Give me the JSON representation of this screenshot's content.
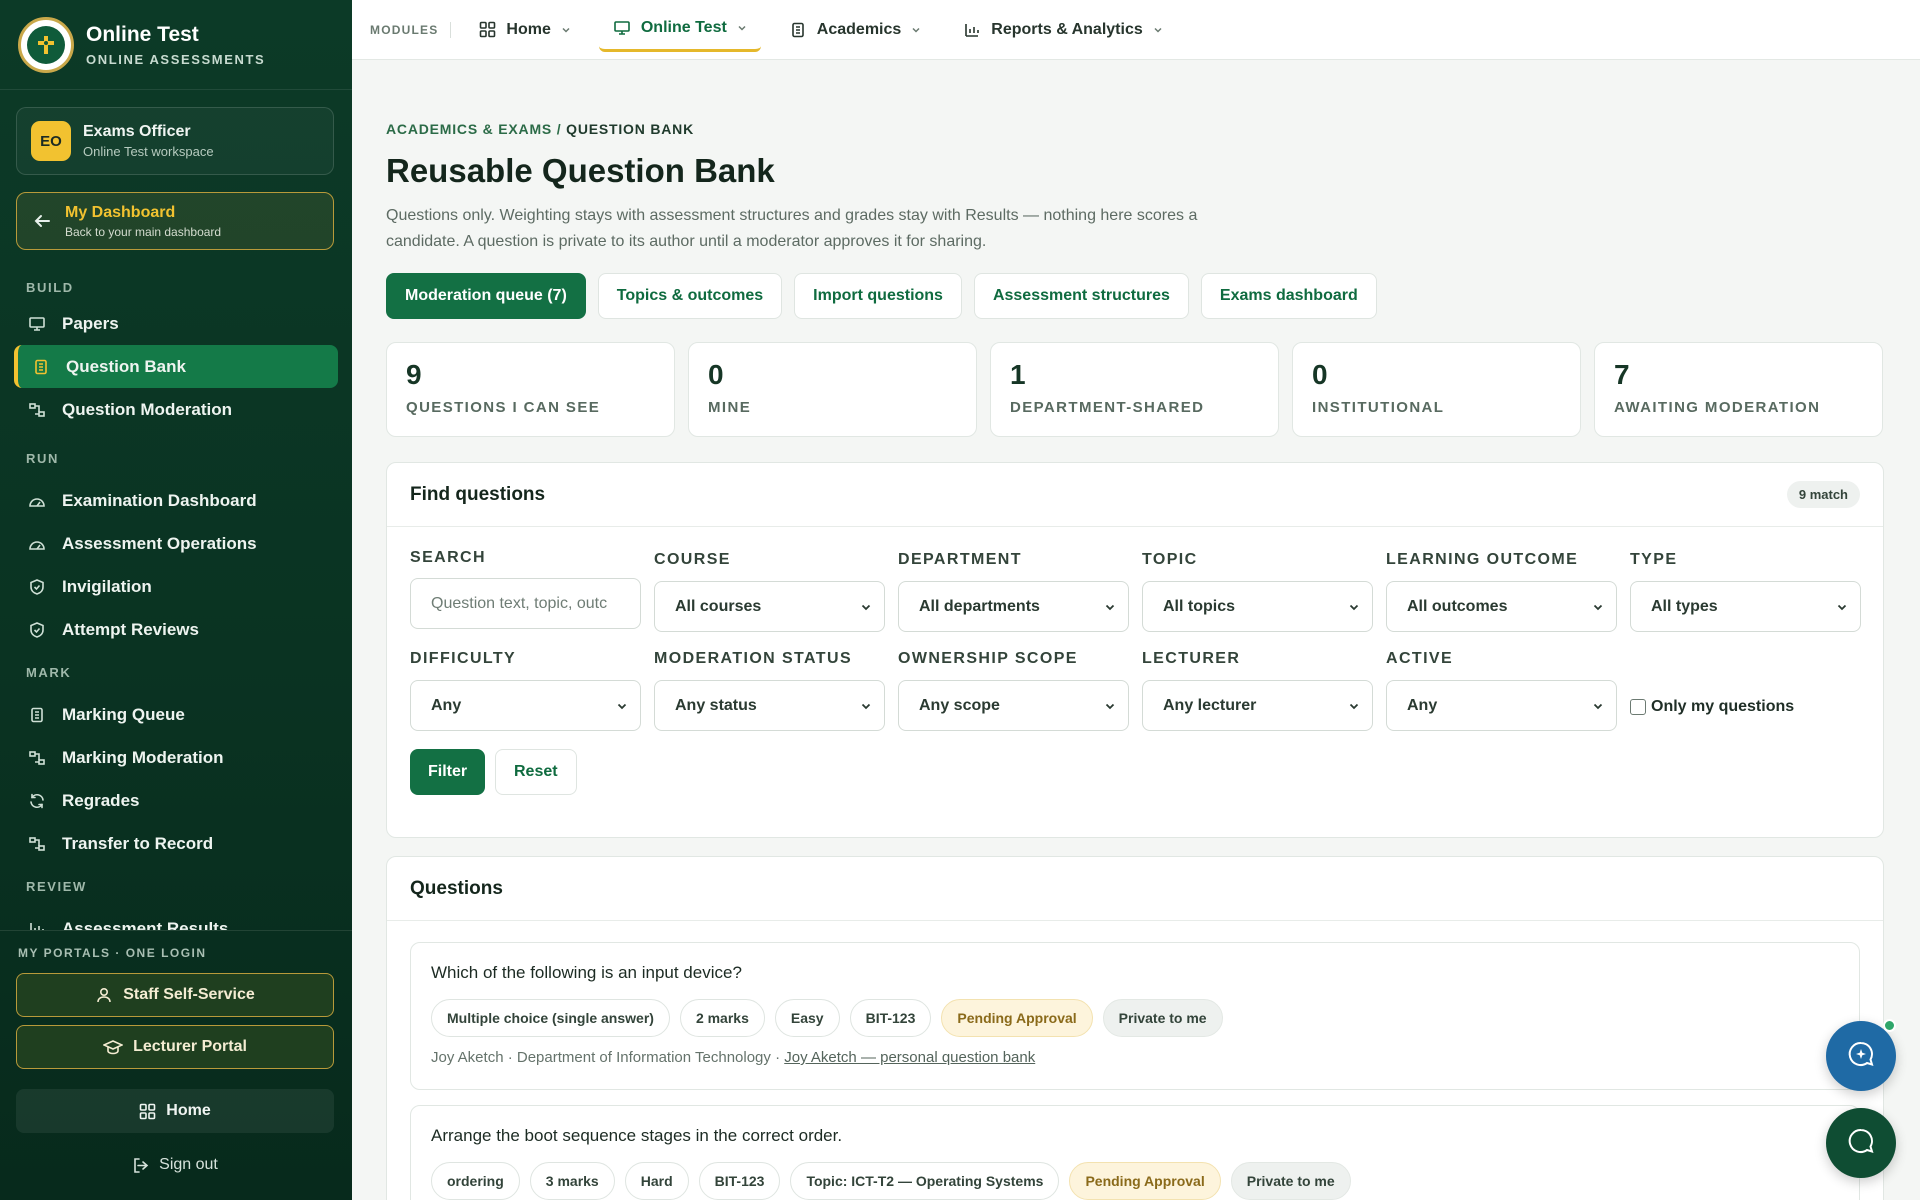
{
  "brand": {
    "title": "Online Test",
    "subtitle": "ONLINE ASSESSMENTS"
  },
  "user": {
    "initials": "EO",
    "name": "Exams Officer",
    "workspace": "Online Test workspace"
  },
  "dashboard": {
    "title": "My Dashboard",
    "subtitle": "Back to your main dashboard"
  },
  "nav": {
    "build": "BUILD",
    "papers": "Papers",
    "question_bank": "Question Bank",
    "question_moderation": "Question Moderation",
    "run": "RUN",
    "examination_dashboard": "Examination Dashboard",
    "assessment_operations": "Assessment Operations",
    "invigilation": "Invigilation",
    "attempt_reviews": "Attempt Reviews",
    "mark": "MARK",
    "marking_queue": "Marking Queue",
    "marking_moderation": "Marking Moderation",
    "regrades": "Regrades",
    "transfer_to_record": "Transfer to Record",
    "review": "REVIEW",
    "assessment_results": "Assessment Results"
  },
  "portals": {
    "title": "MY PORTALS · ONE LOGIN",
    "staff": "Staff Self-Service",
    "lecturer": "Lecturer Portal",
    "home": "Home",
    "signout": "Sign out"
  },
  "topbar": {
    "modules": "MODULES",
    "home": "Home",
    "online_test": "Online Test",
    "academics": "Academics",
    "reports": "Reports & Analytics"
  },
  "page": {
    "breadcrumb_parent": "ACADEMICS & EXAMS",
    "breadcrumb_sep": " / ",
    "breadcrumb_current": "QUESTION BANK",
    "title": "Reusable Question Bank",
    "description": "Questions only. Weighting stays with assessment structures and grades stay with Results — nothing here scores a candidate. A question is private to its author until a moderator approves it for sharing."
  },
  "actions": {
    "moderation_queue": "Moderation queue (7)",
    "topics": "Topics & outcomes",
    "import": "Import questions",
    "structures": "Assessment structures",
    "exams_dashboard": "Exams dashboard"
  },
  "stats": {
    "can_see": {
      "value": "9",
      "label": "QUESTIONS I CAN SEE"
    },
    "mine": {
      "value": "0",
      "label": "MINE"
    },
    "department": {
      "value": "1",
      "label": "DEPARTMENT-SHARED"
    },
    "institutional": {
      "value": "0",
      "label": "INSTITUTIONAL"
    },
    "awaiting": {
      "value": "7",
      "label": "AWAITING MODERATION"
    }
  },
  "find": {
    "title": "Find questions",
    "match": "9 match",
    "search_label": "SEARCH",
    "search_placeholder": "Question text, topic, outc",
    "course_label": "COURSE",
    "course_value": "All courses",
    "department_label": "DEPARTMENT",
    "department_value": "All departments",
    "topic_label": "TOPIC",
    "topic_value": "All topics",
    "outcome_label": "LEARNING OUTCOME",
    "outcome_value": "All outcomes",
    "type_label": "TYPE",
    "type_value": "All types",
    "difficulty_label": "DIFFICULTY",
    "difficulty_value": "Any",
    "moderation_label": "MODERATION STATUS",
    "moderation_value": "Any status",
    "scope_label": "OWNERSHIP SCOPE",
    "scope_value": "Any scope",
    "lecturer_label": "LECTURER",
    "lecturer_value": "Any lecturer",
    "active_label": "ACTIVE",
    "active_value": "Any",
    "only_mine": "Only my questions",
    "filter_btn": "Filter",
    "reset_btn": "Reset"
  },
  "questions": {
    "title": "Questions",
    "items": [
      {
        "text": "Which of the following is an input device?",
        "tags": [
          "Multiple choice (single answer)",
          "2 marks",
          "Easy",
          "BIT-123",
          "Pending Approval",
          "Private to me"
        ],
        "meta_author": "Joy Aketch · Department of Information Technology · ",
        "meta_link": "Joy Aketch — personal question bank"
      },
      {
        "text": "Arrange the boot sequence stages in the correct order.",
        "tags": [
          "ordering",
          "3 marks",
          "Hard",
          "BIT-123",
          "Topic: ICT-T2 — Operating Systems",
          "Pending Approval",
          "Private to me"
        ]
      }
    ]
  },
  "colors": {
    "sidebar": "#0c3a27",
    "accent": "#137044",
    "gold": "#f2c230",
    "pending": "#fdf4dc"
  }
}
